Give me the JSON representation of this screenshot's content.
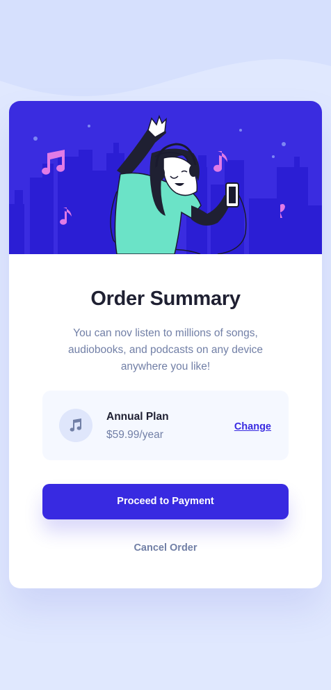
{
  "page": {
    "background": "#e0e8fe",
    "accent": "#382ae1"
  },
  "card": {
    "hero_image": "illustration-hero",
    "title": "Order Summary",
    "description": "You can nov listen to millions of songs, audiobooks, and podcasts on any device anywhere you like!"
  },
  "plan": {
    "icon": "music-note-icon",
    "name": "Annual Plan",
    "price": "$59.99/year",
    "change_label": "Change"
  },
  "actions": {
    "proceed_label": "Proceed to Payment",
    "cancel_label": "Cancel Order"
  }
}
